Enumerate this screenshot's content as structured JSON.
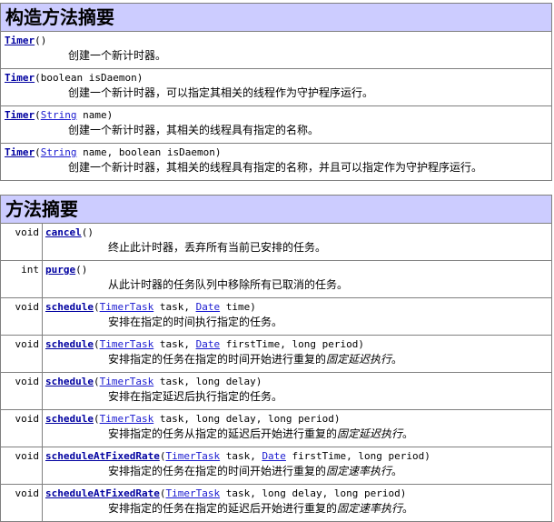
{
  "constructor_summary": {
    "title": "构造方法摘要",
    "rows": [
      {
        "name": "Timer",
        "params": [
          {
            "text": "()"
          }
        ],
        "description": "创建一个新计时器。"
      },
      {
        "name": "Timer",
        "params": [
          {
            "text": "(boolean isDaemon)"
          }
        ],
        "description": "创建一个新计时器，可以指定其相关的线程作为守护程序运行。"
      },
      {
        "name": "Timer",
        "params": [
          {
            "text": "("
          },
          {
            "link": "String"
          },
          {
            "text": " name)"
          }
        ],
        "description": "创建一个新计时器，其相关的线程具有指定的名称。"
      },
      {
        "name": "Timer",
        "params": [
          {
            "text": "("
          },
          {
            "link": "String"
          },
          {
            "text": " name, boolean isDaemon)"
          }
        ],
        "description": "创建一个新计时器，其相关的线程具有指定的名称，并且可以指定作为守护程序运行。"
      }
    ]
  },
  "method_summary": {
    "title": "方法摘要",
    "rows": [
      {
        "modifier": "void",
        "name": "cancel",
        "params": [
          {
            "text": "()"
          }
        ],
        "description": [
          {
            "text": "终止此计时器，丢弃所有当前已安排的任务。"
          }
        ]
      },
      {
        "modifier": "int",
        "name": "purge",
        "params": [
          {
            "text": "()"
          }
        ],
        "description": [
          {
            "text": "从此计时器的任务队列中移除所有已取消的任务。"
          }
        ]
      },
      {
        "modifier": "void",
        "name": "schedule",
        "params": [
          {
            "text": "("
          },
          {
            "link": "TimerTask"
          },
          {
            "text": " task, "
          },
          {
            "link": "Date"
          },
          {
            "text": " time)"
          }
        ],
        "description": [
          {
            "text": "安排在指定的时间执行指定的任务。"
          }
        ]
      },
      {
        "modifier": "void",
        "name": "schedule",
        "params": [
          {
            "text": "("
          },
          {
            "link": "TimerTask"
          },
          {
            "text": " task, "
          },
          {
            "link": "Date"
          },
          {
            "text": " firstTime, long period)"
          }
        ],
        "description": [
          {
            "text": "安排指定的任务在指定的时间开始进行重复的"
          },
          {
            "em": "固定延迟执行"
          },
          {
            "text": "。"
          }
        ]
      },
      {
        "modifier": "void",
        "name": "schedule",
        "params": [
          {
            "text": "("
          },
          {
            "link": "TimerTask"
          },
          {
            "text": " task, long delay)"
          }
        ],
        "description": [
          {
            "text": "安排在指定延迟后执行指定的任务。"
          }
        ]
      },
      {
        "modifier": "void",
        "name": "schedule",
        "params": [
          {
            "text": "("
          },
          {
            "link": "TimerTask"
          },
          {
            "text": " task, long delay, long period)"
          }
        ],
        "description": [
          {
            "text": "安排指定的任务从指定的延迟后开始进行重复的"
          },
          {
            "em": "固定延迟执行"
          },
          {
            "text": "。"
          }
        ]
      },
      {
        "modifier": "void",
        "name": "scheduleAtFixedRate",
        "params": [
          {
            "text": "("
          },
          {
            "link": "TimerTask"
          },
          {
            "text": " task, "
          },
          {
            "link": "Date"
          },
          {
            "text": " firstTime, long period)"
          }
        ],
        "description": [
          {
            "text": "安排指定的任务在指定的时间开始进行重复的"
          },
          {
            "em": "固定速率执行"
          },
          {
            "text": "。"
          }
        ]
      },
      {
        "modifier": "void",
        "name": "scheduleAtFixedRate",
        "params": [
          {
            "text": "("
          },
          {
            "link": "TimerTask"
          },
          {
            "text": " task, long delay, long period)"
          }
        ],
        "description": [
          {
            "text": "安排指定的任务在指定的延迟后开始进行重复的"
          },
          {
            "em": "固定速率执行"
          },
          {
            "text": "。"
          }
        ]
      }
    ]
  }
}
